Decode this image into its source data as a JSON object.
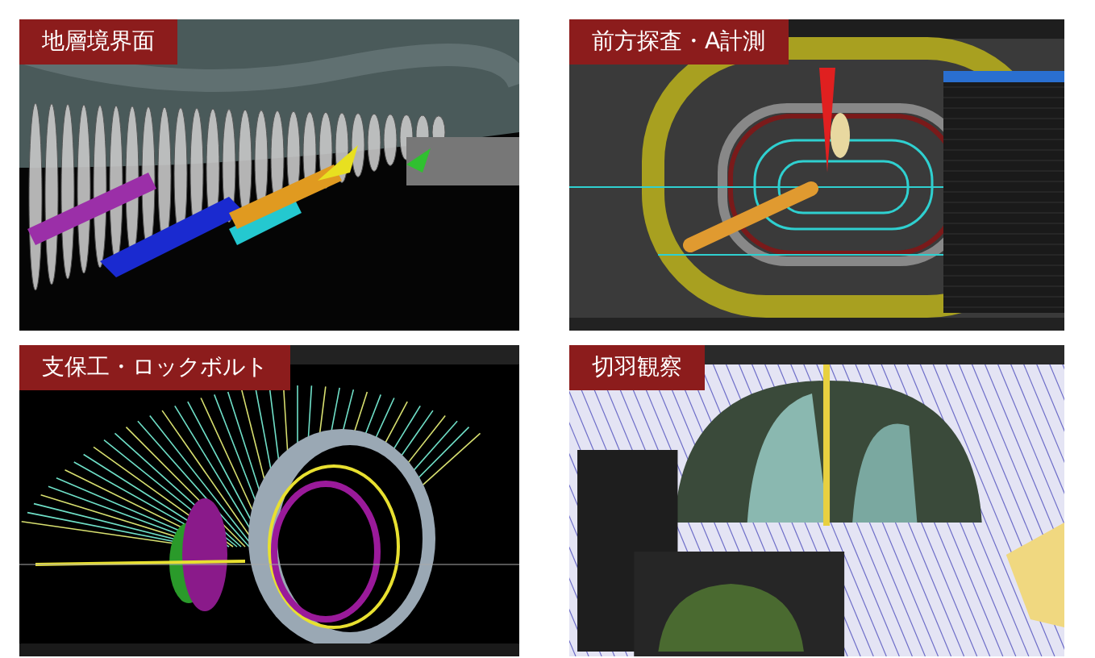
{
  "panels": [
    {
      "title": "地層境界面",
      "kind": "strata"
    },
    {
      "title": "前方探査・A計測",
      "kind": "probe"
    },
    {
      "title": "支保工・ロックボルト",
      "kind": "support"
    },
    {
      "title": "切羽観察",
      "kind": "face"
    }
  ]
}
